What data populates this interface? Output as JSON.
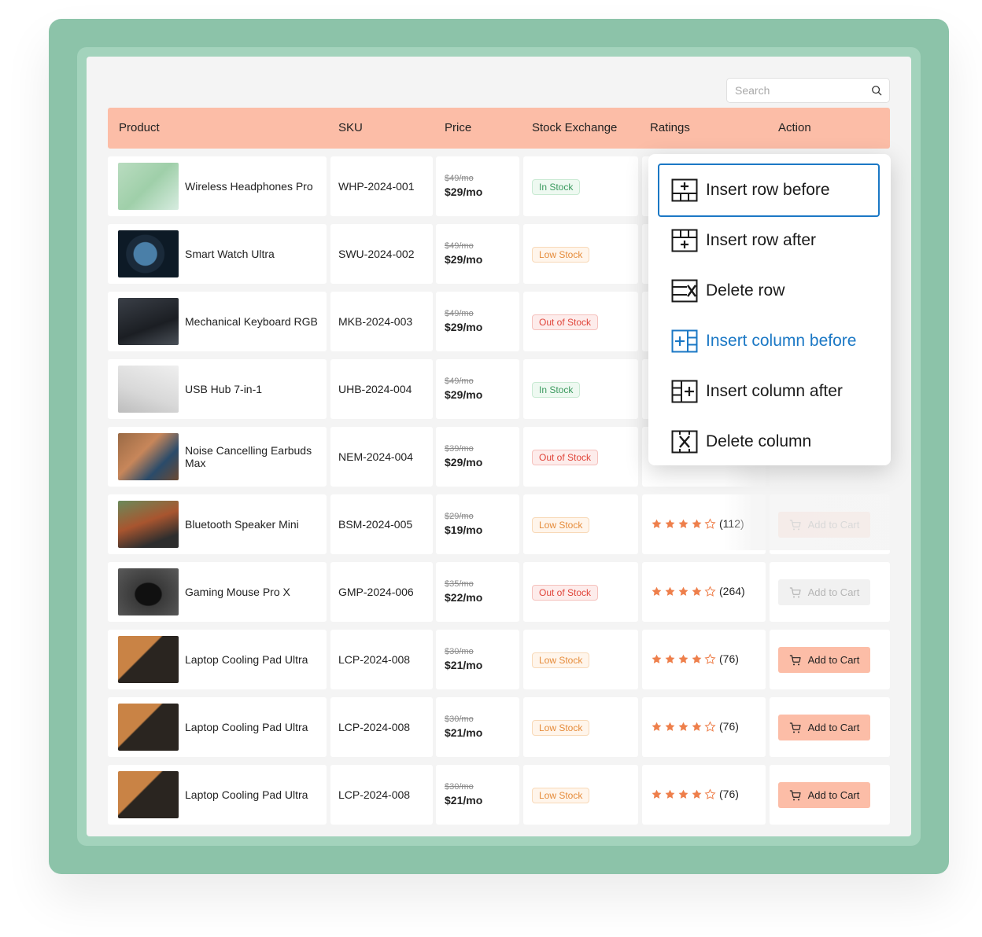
{
  "search": {
    "placeholder": "Search"
  },
  "header": {
    "product": "Product",
    "sku": "SKU",
    "price": "Price",
    "stock": "Stock Exchange",
    "ratings": "Ratings",
    "action": "Action"
  },
  "context_menu": {
    "items": [
      {
        "label": "Insert row before",
        "icon": "insert-row-before-icon"
      },
      {
        "label": "Insert row after",
        "icon": "insert-row-after-icon"
      },
      {
        "label": "Delete row",
        "icon": "delete-row-icon"
      },
      {
        "label": "Insert column before",
        "icon": "insert-column-before-icon"
      },
      {
        "label": "Insert column after",
        "icon": "insert-column-after-icon"
      },
      {
        "label": "Delete column",
        "icon": "delete-column-icon"
      }
    ],
    "accent_color": "#1b78c5"
  },
  "rows": [
    {
      "name": "Wireless Headphones Pro",
      "sku": "WHP-2024-001",
      "old_price": "$49/mo",
      "price": "$29/mo",
      "stock": "In Stock",
      "rating": null,
      "count": null,
      "cart": null,
      "cart_enabled": null
    },
    {
      "name": "Smart Watch Ultra",
      "sku": "SWU-2024-002",
      "old_price": "$49/mo",
      "price": "$29/mo",
      "stock": "Low Stock",
      "rating": null,
      "count": null,
      "cart": null,
      "cart_enabled": null
    },
    {
      "name": "Mechanical Keyboard RGB",
      "sku": "MKB-2024-003",
      "old_price": "$49/mo",
      "price": "$29/mo",
      "stock": "Out of Stock",
      "rating": null,
      "count": null,
      "cart": null,
      "cart_enabled": null
    },
    {
      "name": "USB Hub 7-in-1",
      "sku": "UHB-2024-004",
      "old_price": "$49/mo",
      "price": "$29/mo",
      "stock": "In Stock",
      "rating": null,
      "count": null,
      "cart": null,
      "cart_enabled": null
    },
    {
      "name": "Noise Cancelling Earbuds Max",
      "sku": "NEM-2024-004",
      "old_price": "$39/mo",
      "price": "$29/mo",
      "stock": "Out of Stock",
      "rating": null,
      "count": null,
      "cart": null,
      "cart_enabled": null
    },
    {
      "name": "Bluetooth Speaker Mini",
      "sku": "BSM-2024-005",
      "old_price": "$29/mo",
      "price": "$19/mo",
      "stock": "Low Stock",
      "rating": 4,
      "count": "(112)",
      "cart": "Add to Cart",
      "cart_enabled": true
    },
    {
      "name": "Gaming Mouse Pro X",
      "sku": "GMP-2024-006",
      "old_price": "$35/mo",
      "price": "$22/mo",
      "stock": "Out of Stock",
      "rating": 4,
      "count": "(264)",
      "cart": "Add to Cart",
      "cart_enabled": false
    },
    {
      "name": "Laptop Cooling Pad Ultra",
      "sku": "LCP-2024-008",
      "old_price": "$30/mo",
      "price": "$21/mo",
      "stock": "Low Stock",
      "rating": 4,
      "count": "(76)",
      "cart": "Add to Cart",
      "cart_enabled": true
    },
    {
      "name": "Laptop Cooling Pad Ultra",
      "sku": "LCP-2024-008",
      "old_price": "$30/mo",
      "price": "$21/mo",
      "stock": "Low Stock",
      "rating": 4,
      "count": "(76)",
      "cart": "Add to Cart",
      "cart_enabled": true
    },
    {
      "name": "Laptop Cooling Pad Ultra",
      "sku": "LCP-2024-008",
      "old_price": "$30/mo",
      "price": "$21/mo",
      "stock": "Low Stock",
      "rating": 4,
      "count": "(76)",
      "cart": "Add to Cart",
      "cart_enabled": true
    }
  ],
  "colors": {
    "header_bg": "#fcbda7",
    "frame_green": "#8cc3a9",
    "star": "#ee7f4b",
    "cart_bg": "#fcbda7"
  }
}
